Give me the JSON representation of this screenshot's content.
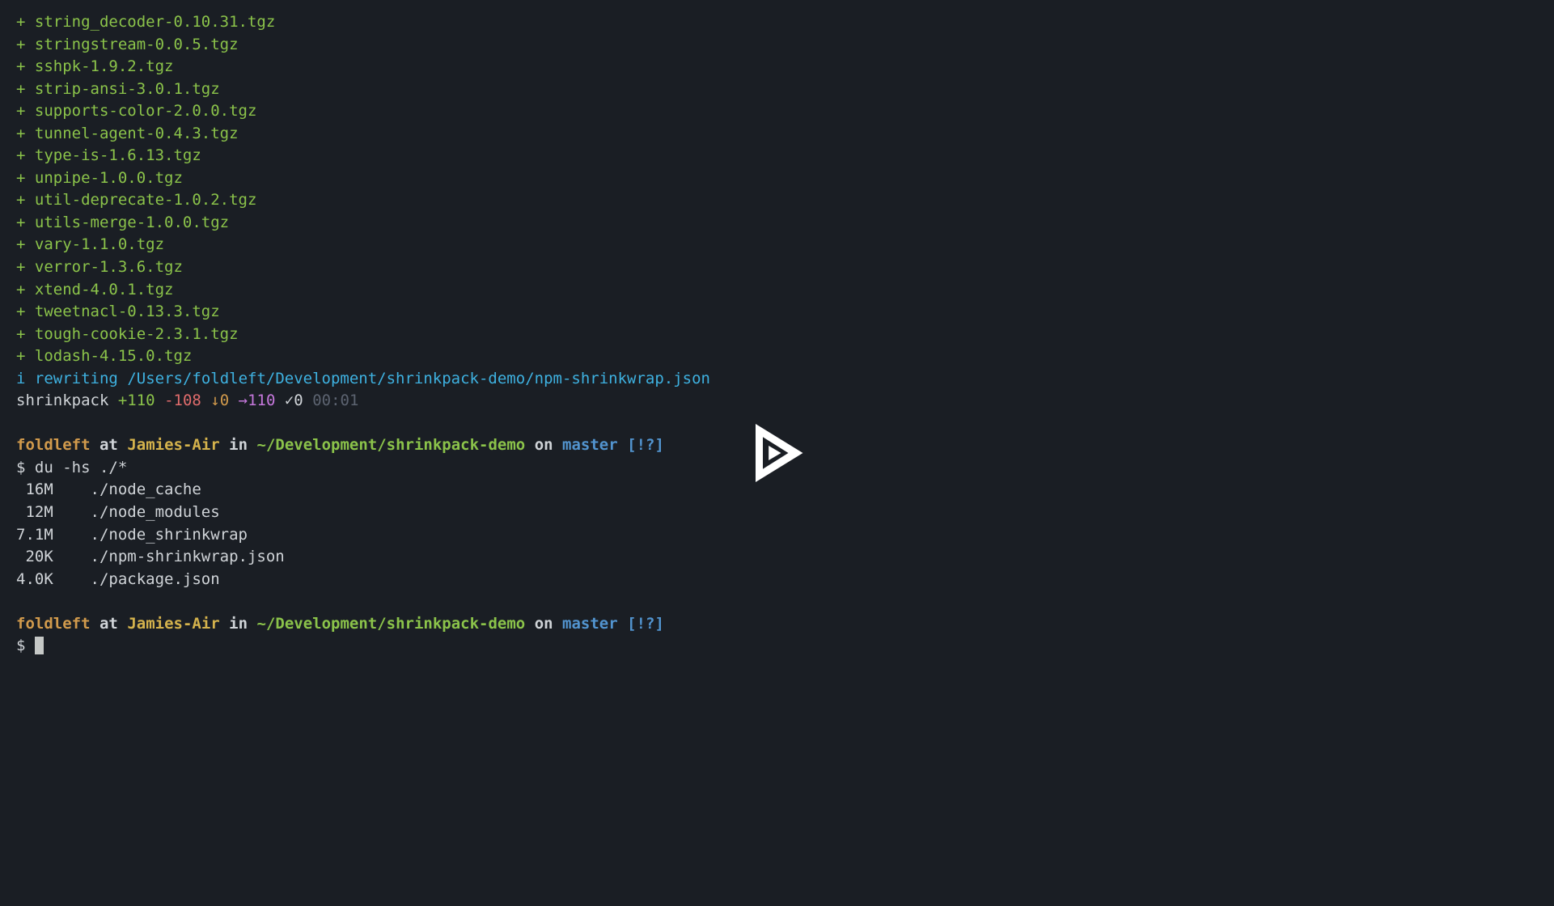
{
  "packages": [
    "string_decoder-0.10.31.tgz",
    "stringstream-0.0.5.tgz",
    "sshpk-1.9.2.tgz",
    "strip-ansi-3.0.1.tgz",
    "supports-color-2.0.0.tgz",
    "tunnel-agent-0.4.3.tgz",
    "type-is-1.6.13.tgz",
    "unpipe-1.0.0.tgz",
    "util-deprecate-1.0.2.tgz",
    "utils-merge-1.0.0.tgz",
    "vary-1.1.0.tgz",
    "verror-1.3.6.tgz",
    "xtend-4.0.1.tgz",
    "tweetnacl-0.13.3.tgz",
    "tough-cookie-2.3.1.tgz",
    "lodash-4.15.0.tgz"
  ],
  "rewrite": {
    "i": "i",
    "label": "rewriting",
    "path": "/Users/foldleft/Development/shrinkpack-demo/npm-shrinkwrap.json"
  },
  "summary": {
    "name": "shrinkpack",
    "add": "+110",
    "remove": "-108",
    "down": "↓0",
    "right": "→110",
    "check": "✓0",
    "time": "00:01"
  },
  "prompt1": {
    "user": "foldleft",
    "at": "at",
    "host": "Jamies-Air",
    "in": "in",
    "path": "~/Development/shrinkpack-demo",
    "on": "on",
    "branch": "master",
    "status": "[!?]"
  },
  "command": {
    "sigil": "$",
    "text": "du -hs ./*"
  },
  "du": [
    {
      "size": " 16M",
      "path": "./node_cache"
    },
    {
      "size": " 12M",
      "path": "./node_modules"
    },
    {
      "size": "7.1M",
      "path": "./node_shrinkwrap"
    },
    {
      "size": " 20K",
      "path": "./npm-shrinkwrap.json"
    },
    {
      "size": "4.0K",
      "path": "./package.json"
    }
  ],
  "prompt2": {
    "user": "foldleft",
    "at": "at",
    "host": "Jamies-Air",
    "in": "in",
    "path": "~/Development/shrinkpack-demo",
    "on": "on",
    "branch": "master",
    "status": "[!?]"
  },
  "prompt2_sigil": "$"
}
